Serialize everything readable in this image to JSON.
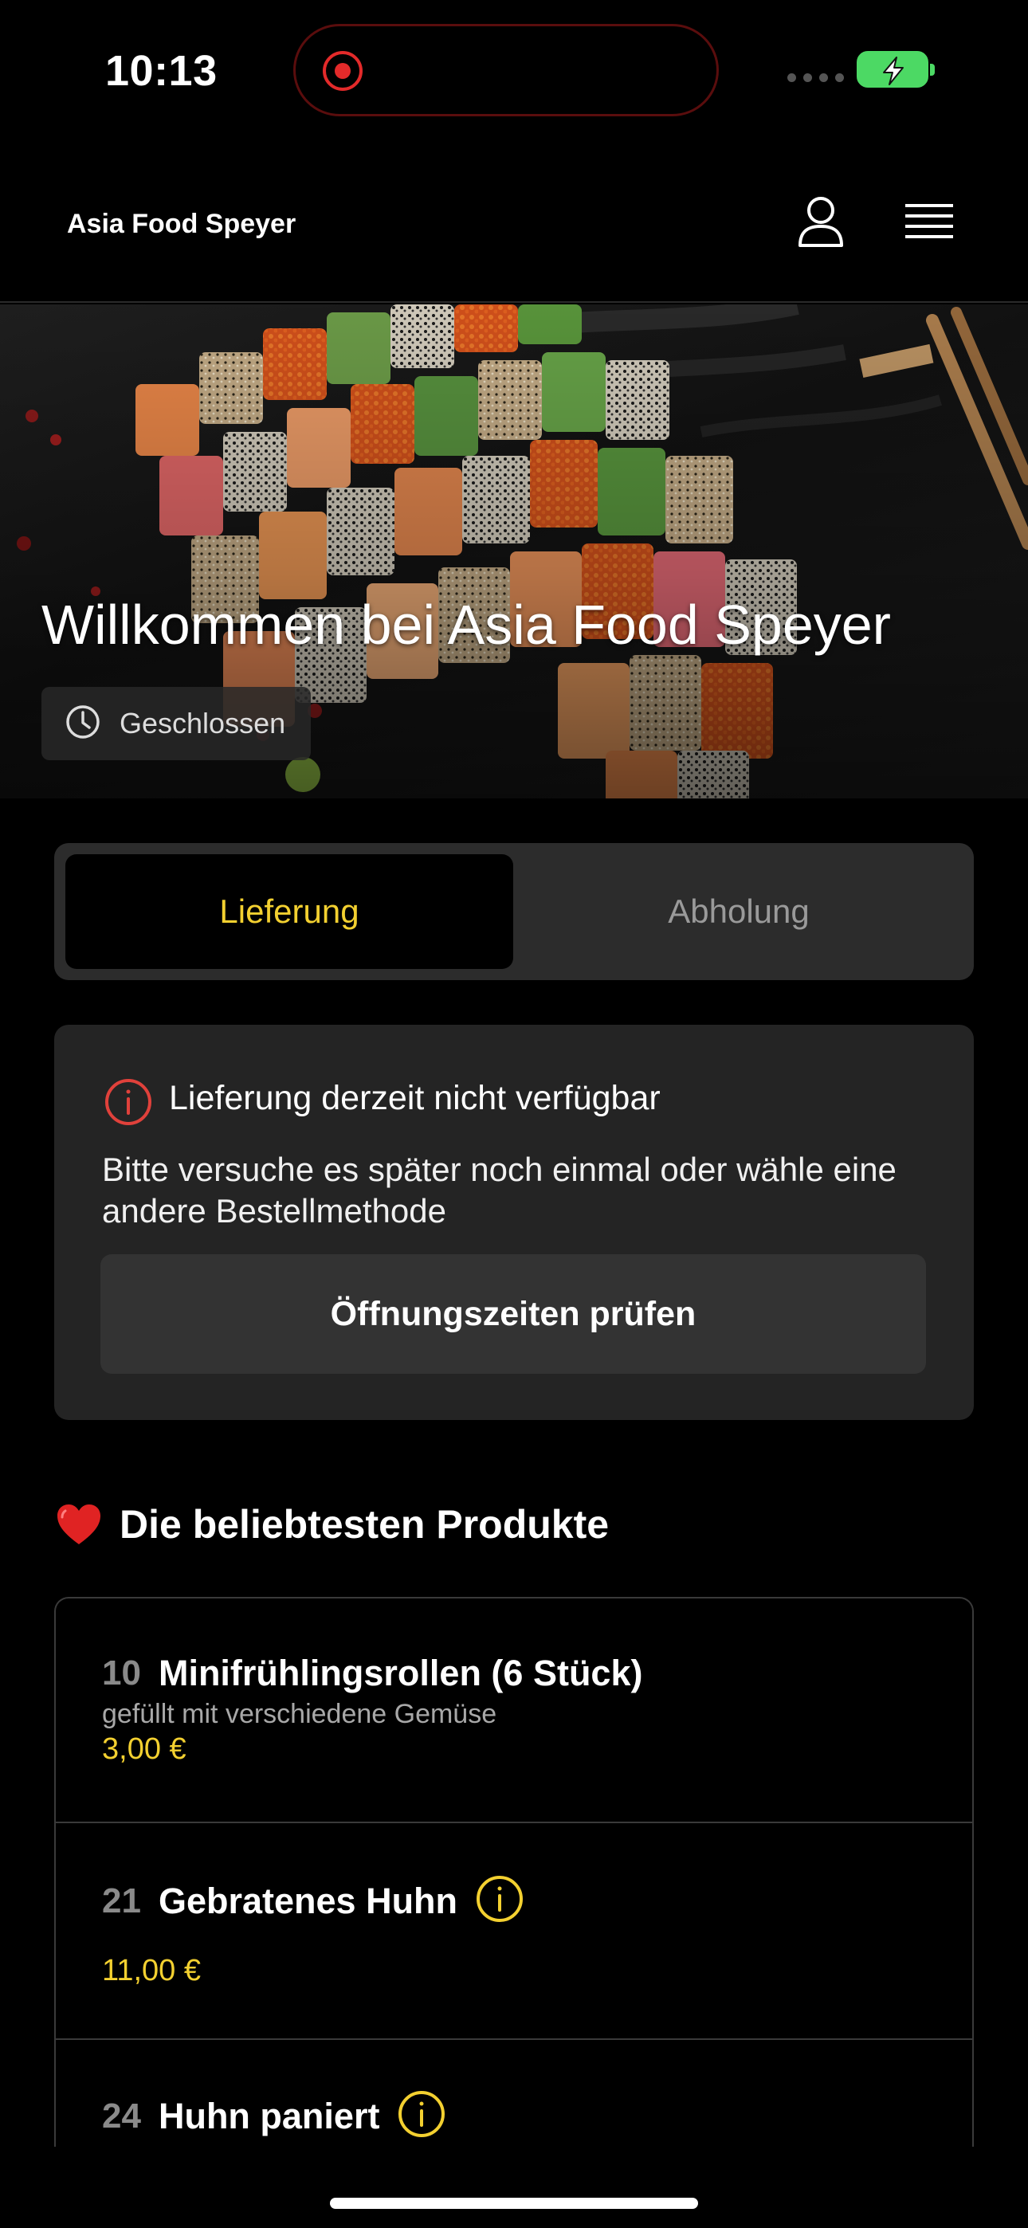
{
  "status_bar": {
    "time": "10:13"
  },
  "header": {
    "brand": "Asia Food Speyer",
    "icons": [
      "user-icon",
      "hamburger-menu-icon"
    ]
  },
  "hero": {
    "title": "Willkommen bei Asia Food Speyer",
    "status": "Geschlossen"
  },
  "order_mode": {
    "options": [
      "Lieferung",
      "Abholung"
    ],
    "selected": "Lieferung"
  },
  "notice": {
    "title": "Lieferung derzeit nicht verfügbar",
    "text": "Bitte versuche es später noch einmal oder wähle eine andere Bestellmethode",
    "button": "Öffnungszeiten prüfen"
  },
  "popular": {
    "title": "Die beliebtesten Produkte",
    "products": [
      {
        "number": "10",
        "name": "Minifrühlingsrollen (6 Stück)",
        "description": "gefüllt mit verschiedene Gemüse",
        "price": "3,00 €",
        "has_info": false
      },
      {
        "number": "21",
        "name": "Gebratenes Huhn",
        "description": "",
        "price": "11,00 €",
        "has_info": true
      },
      {
        "number": "24",
        "name": "Huhn paniert",
        "description": "",
        "price": "",
        "has_info": true
      }
    ]
  },
  "colors": {
    "accent": "#f3d030",
    "alert": "#e0413b",
    "card": "#242424",
    "background": "#000000"
  }
}
